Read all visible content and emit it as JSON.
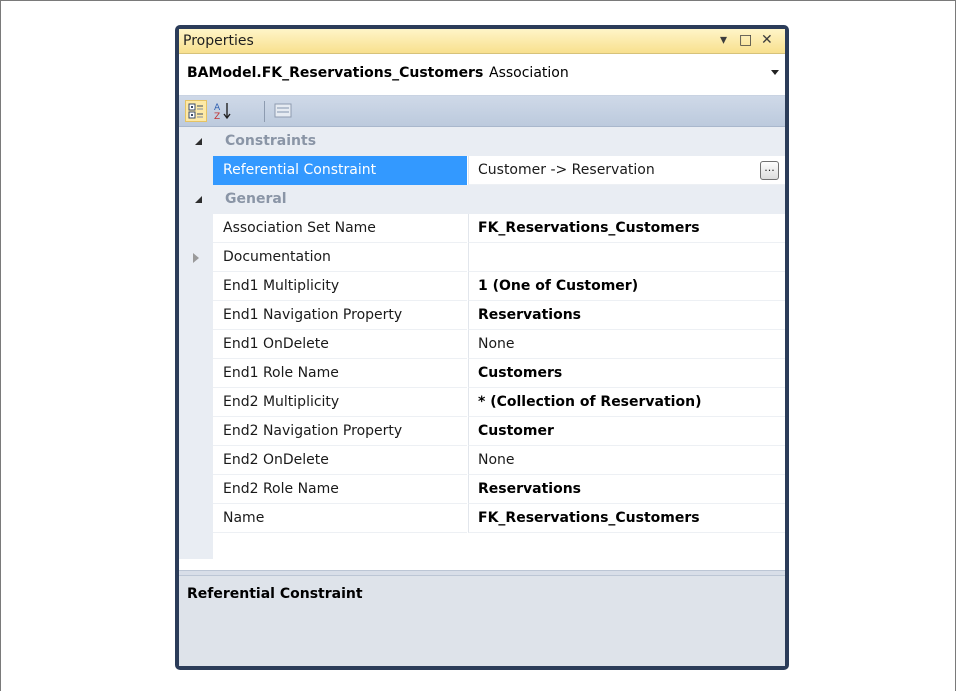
{
  "panel": {
    "title": "Properties",
    "controls": {
      "pin": "▾",
      "maximize": "□",
      "close": "✕"
    }
  },
  "selector": {
    "object_name": "BAModel.FK_Reservations_Customers",
    "object_type": "Association"
  },
  "toolbar": {
    "buttons": [
      {
        "name": "categorized",
        "icon": "categorized-icon",
        "active": true
      },
      {
        "name": "alphabetical",
        "icon": "sort-az-icon",
        "active": false
      },
      {
        "name": "property-pages",
        "icon": "property-pages-icon",
        "active": false
      }
    ]
  },
  "categories": [
    {
      "label": "Constraints",
      "properties": [
        {
          "name": "Referential Constraint",
          "value": "Customer -> Reservation",
          "selected": true,
          "has_button": true,
          "button_label": "..."
        }
      ]
    },
    {
      "label": "General",
      "properties": [
        {
          "name": "Association Set Name",
          "value": "FK_Reservations_Customers",
          "bold": true
        },
        {
          "name": "Documentation",
          "value": "",
          "expandable": true
        },
        {
          "name": "End1 Multiplicity",
          "value": "1 (One of Customer)",
          "bold": true
        },
        {
          "name": "End1 Navigation Property",
          "value": "Reservations",
          "bold": true
        },
        {
          "name": "End1 OnDelete",
          "value": "None"
        },
        {
          "name": "End1 Role Name",
          "value": "Customers",
          "bold": true
        },
        {
          "name": "End2 Multiplicity",
          "value": "* (Collection of Reservation)",
          "bold": true
        },
        {
          "name": "End2 Navigation Property",
          "value": "Customer",
          "bold": true
        },
        {
          "name": "End2 OnDelete",
          "value": "None"
        },
        {
          "name": "End2 Role Name",
          "value": "Reservations",
          "bold": true
        },
        {
          "name": "Name",
          "value": "FK_Reservations_Customers",
          "bold": true
        }
      ]
    }
  ],
  "description": {
    "title": "Referential Constraint"
  },
  "colors": {
    "selection": "#3399ff",
    "window_border": "#2b3c59",
    "title_gradient_top": "#fff5c8",
    "title_gradient_bottom": "#f8e08e"
  }
}
